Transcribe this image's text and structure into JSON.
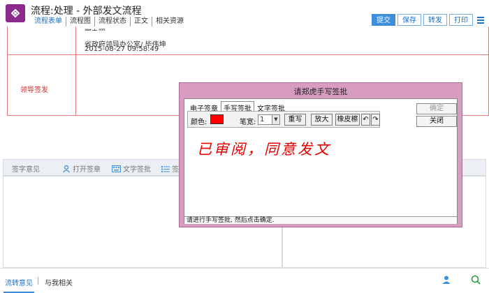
{
  "header": {
    "title": "流程:处理 - 外部发文流程",
    "tabs": [
      "流程表单",
      "流程图",
      "流程状态",
      "正文",
      "相关资源"
    ],
    "actions": [
      "提交",
      "保存",
      "转发",
      "打印"
    ]
  },
  "form": {
    "cut_text": "国办照",
    "opinion_dept": "省政府领导办公室/ 毕伟坤",
    "opinion_time": "2015-08-27 09:58:49",
    "lead_label": "领导签发"
  },
  "lower": {
    "toolbar": {
      "opinion_label": "签字意见",
      "open_sign": "打开签章",
      "text_sign": "文字签批",
      "sign_cut": "签"
    }
  },
  "footer": {
    "tab_flow": "流转意见",
    "tab_related": "与我相关"
  },
  "dialog": {
    "title": "请郑虎手写签批",
    "tabs": [
      "电子签章",
      "手写签批",
      "文字签批"
    ],
    "color_label": "颜色:",
    "pen_width_label": "笔宽:",
    "pen_width_value": "1",
    "rewrite": "重写",
    "zoom": "放大",
    "eraser": "橡皮檫",
    "confirm": "确定",
    "close": "关闭",
    "handwriting": "已审阅，同意发文",
    "status": "请进行手写签批, 然后点击确定."
  },
  "colors": {
    "accent": "#3d8fdc",
    "brand": "#8b2a8b",
    "dialog_frame": "#d79cc0",
    "pen_color": "#ff0000"
  }
}
